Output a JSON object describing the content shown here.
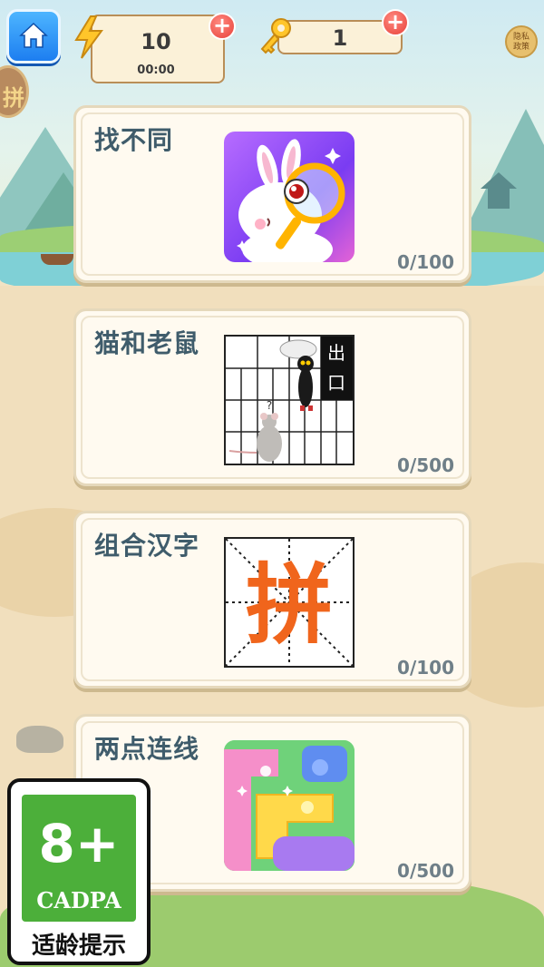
{
  "top_bar": {
    "energy": {
      "value": "10",
      "timer": "00:00"
    },
    "keys": {
      "value": "1"
    },
    "plus_symbol": "+",
    "privacy_label_line1": "隐私",
    "privacy_label_line2": "政策"
  },
  "side_badge": {
    "glyph": "拼"
  },
  "games": [
    {
      "title": "找不同",
      "progress": "0/100",
      "thumb_icon": "magnifier-rabbit-icon"
    },
    {
      "title": "猫和老鼠",
      "progress": "0/500",
      "thumb_icon": "cat-mouse-maze-icon",
      "exit_label_1": "出",
      "exit_label_2": "口"
    },
    {
      "title": "组合汉字",
      "progress": "0/100",
      "thumb_icon": "chinese-character-grid-icon",
      "character": "拼"
    },
    {
      "title": "两点连线",
      "progress": "0/500",
      "thumb_icon": "connect-dots-puzzle-icon"
    }
  ],
  "age_rating": {
    "age": "8+",
    "org": "CADPA",
    "label": "适龄提示"
  },
  "colors": {
    "accent_blue": "#1d7ef0",
    "plus_red": "#e8413a",
    "title_text": "#3f5c6b",
    "age_green": "#4caf3a",
    "char_orange": "#f0651c"
  }
}
